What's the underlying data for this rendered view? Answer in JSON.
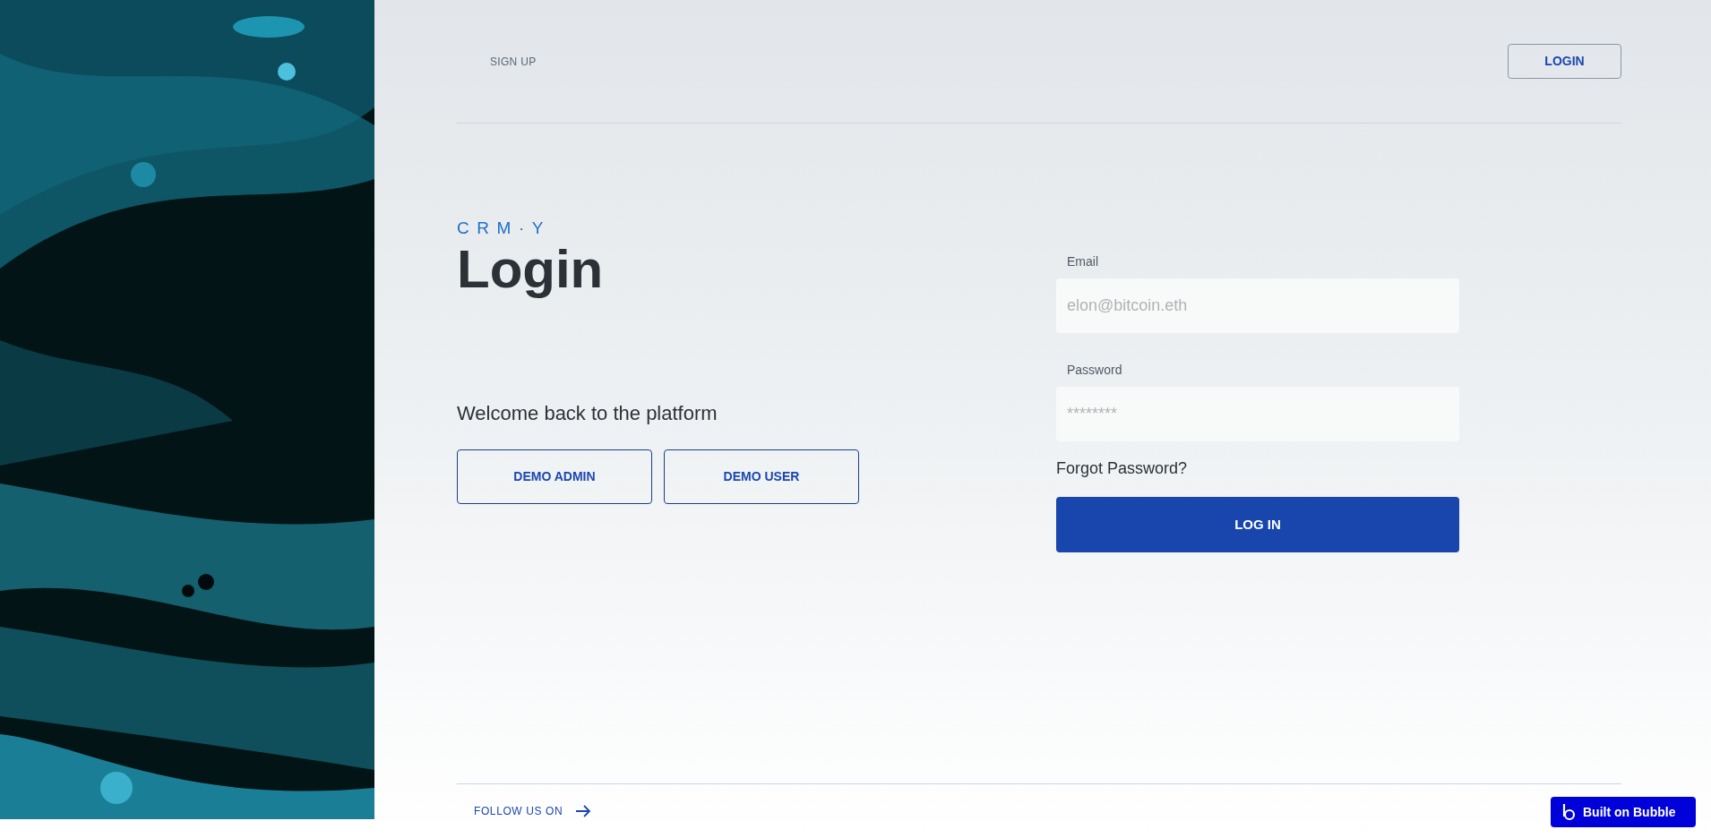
{
  "nav": {
    "signup": "SIGN UP",
    "login": "LOGIN"
  },
  "logo": "CRM·Y",
  "title": "Login",
  "welcome": "Welcome back to the platform",
  "demo_buttons": [
    "DEMO ADMIN",
    "DEMO USER"
  ],
  "form": {
    "fields": [
      {
        "label": "Email",
        "placeholder": "elon@bitcoin.eth"
      },
      {
        "label": "Password",
        "placeholder": "********"
      }
    ],
    "forgot": "Forgot Password?",
    "submit": "LOG IN"
  },
  "footer": {
    "follow": "FOLLOW US ON"
  },
  "badge": "Built on Bubble"
}
